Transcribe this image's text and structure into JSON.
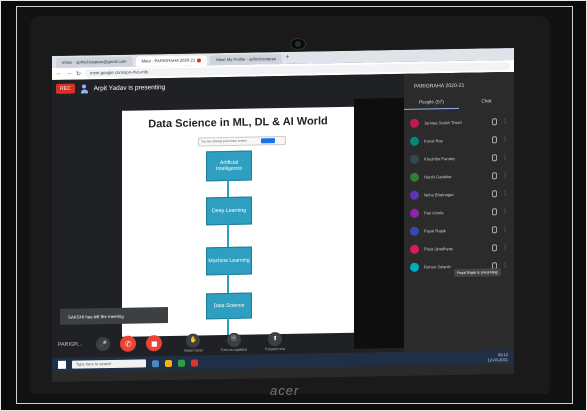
{
  "browser": {
    "tabs": [
      {
        "label": "Inbox - opfmcbcwprpo@gmail.com",
        "active": false
      },
      {
        "label": "Meet - PARIGRAHA 2020-21",
        "active": true,
        "recording": true
      },
      {
        "label": "Meet My Profile - opfmcbcwprpo",
        "active": false
      }
    ],
    "new_tab_label": "+",
    "url": "meet.google.com/spn-rfvo-mfo"
  },
  "meet": {
    "rec_label": "REC",
    "presenter_text": "Arpit Yadav is presenting",
    "panel_title": "PARIGRAHA 2020-21",
    "panel_tabs": [
      {
        "label": "People (57)",
        "active": true
      },
      {
        "label": "Chat",
        "active": false
      }
    ],
    "participants": [
      {
        "name": "Jamtaa Satish Tiwari",
        "color": "#c2185b"
      },
      {
        "name": "Kunal Roy",
        "color": "#00897b"
      },
      {
        "name": "Khushbo Pandey",
        "color": "#37474f"
      },
      {
        "name": "Harsh Gadekar",
        "color": "#2e7d32"
      },
      {
        "name": "Neha Bhatnagar",
        "color": "#5e35b1"
      },
      {
        "name": "Pari Ichola",
        "color": "#8e24aa"
      },
      {
        "name": "Payal Rajak",
        "color": "#3949ab"
      },
      {
        "name": "Priya Upadhyay",
        "color": "#d81b60"
      },
      {
        "name": "Rohan Solanki",
        "color": "#00acc1"
      }
    ],
    "tooltip": "Payal Rajak is presenting",
    "toast": "SAKSHI has left the meeting",
    "meeting_code": "PARIGR...",
    "controls": {
      "raise_hand": "Raise hand",
      "turn_on_captions": "Turn on captions",
      "present": "Present now"
    }
  },
  "slide": {
    "title": "Data Science in ML, DL & AI World",
    "share_chip": "You are sharing your entire screen",
    "share_stop": "Stop sharing",
    "nodes": [
      "Artificial Intelligence",
      "Deep Learning",
      "Machine Learning",
      "Data Science"
    ]
  },
  "taskbar": {
    "search_placeholder": "Type here to search",
    "time": "09:12",
    "date": "12-03-2021"
  },
  "device_brand": "acer"
}
